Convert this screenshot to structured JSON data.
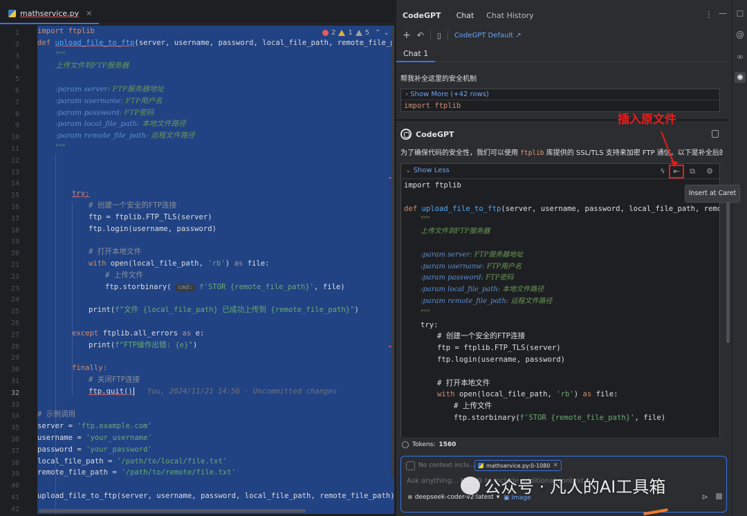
{
  "editor": {
    "file_tab": "mathservice.py",
    "inspection": {
      "errors": "2",
      "warnings": "1",
      "weak": "5"
    },
    "line_numbers": [
      "1",
      "2",
      "3",
      "4",
      "5",
      "6",
      "7",
      "8",
      "9",
      "10",
      "11",
      "12",
      "13",
      "14",
      "15",
      "16",
      "17",
      "18",
      "19",
      "20",
      "21",
      "22",
      "23",
      "24",
      "25",
      "26",
      "27",
      "28",
      "29",
      "30",
      "31",
      "32",
      "33",
      "34",
      "35",
      "36",
      "37",
      "38",
      "39",
      "40",
      "41",
      "42"
    ],
    "current_line": "32",
    "code": {
      "l1": "import ftplib",
      "l2_def": "def ",
      "l2_fn": "upload_file_to_ftp",
      "l2_sig": "(server, username, password, local_file_path, remote_file_path",
      "l3": "\"\"\"",
      "l4": "上传文件到FTP服务器",
      "l6_p": ":param ",
      "l6_k": "server",
      "l6_d": ": FTP服务器地址",
      "l7_p": ":param ",
      "l7_k": "username",
      "l7_d": ": FTP用户名",
      "l8_p": ":param ",
      "l8_k": "password",
      "l8_d": ": FTP密码",
      "l9_p": ":param ",
      "l9_k": "local_file_path",
      "l9_d": ": 本地文件路径",
      "l10_p": ":param ",
      "l10_k": "remote_file_path",
      "l10_d": ": 远程文件路径",
      "l11": "\"\"\"",
      "l15": "try:",
      "l16": "# 创建一个安全的FTP连接",
      "l17": "ftp = ftplib.FTP_TLS(server)",
      "l18": "ftp.login(username, password)",
      "l20": "# 打开本地文件",
      "l21_kw": "with ",
      "l21_a": "open(local_file_path, ",
      "l21_s": "'rb'",
      "l21_b": ") ",
      "l21_as": "as ",
      "l21_c": "file:",
      "l22": "# 上传文件",
      "l23_a": "ftp.storbinary(",
      "l23_hint": "cmd:",
      "l23_s": "f'STOR {remote_file_path}'",
      "l23_b": ", file)",
      "l25_a": "print(",
      "l25_s": "f\"文件 {local_file_path} 已成功上传到 {remote_file_path}\"",
      "l25_b": ")",
      "l27_kw": "except ",
      "l27_a": "ftplib.all_errors ",
      "l27_as": "as ",
      "l27_b": "e:",
      "l28_a": "print(",
      "l28_s": "f\"FTP操作出错: {e}\"",
      "l28_b": ")",
      "l30": "finally:",
      "l31": "# 关闭FTP连接",
      "l32": "ftp.quit()",
      "l32_blame": "You, 2024/11/21 14:56 · Uncommitted changes",
      "l34": "# 示例调用",
      "l35_a": "server = ",
      "l35_s": "'ftp.example.com'",
      "l36_a": "username = ",
      "l36_s": "'your_username'",
      "l37_a": "password = ",
      "l37_s": "'your_password'",
      "l38_a": "local_file_path = ",
      "l38_s": "'/path/to/local/file.txt'",
      "l39_a": "remote_file_path = ",
      "l39_s": "'/path/to/remote/file.txt'",
      "l41": "upload_file_to_ftp(server, username, password, local_file_path, remote_file_path)"
    }
  },
  "panel": {
    "title": "CodeGPT",
    "tabs": [
      "Chat",
      "Chat History"
    ],
    "model_link": "CodeGPT Default ↗",
    "chat_tab": "Chat 1",
    "user_prompt": "帮我补全这里的安全机制",
    "show_more": "Show More (+42 rows)",
    "user_code": "import ftplib",
    "assistant_name": "CodeGPT",
    "intro_a": "为了确保代码的安全性，我们可以使用 ",
    "intro_code": "ftplib",
    "intro_b": " 库提供的 SSL/TLS 支持来加密 FTP 通信。以下是补全后的代码:",
    "show_less": "Show Less",
    "block": {
      "b1": "import ftplib",
      "b3_def": "def ",
      "b3_fn": "upload_file_to_ftp",
      "b3_sig": "(server, username, password, local_file_path, remote_",
      "b4": "\"\"\"",
      "b5": "上传文件到FTP服务器",
      "b7_p": ":param ",
      "b7_k": "server",
      "b7_d": ": FTP服务器地址",
      "b8_p": ":param ",
      "b8_k": "username",
      "b8_d": ": FTP用户名",
      "b9_p": ":param ",
      "b9_k": "password",
      "b9_d": ": FTP密码",
      "b10_p": ":param ",
      "b10_k": "local_file_path",
      "b10_d": ": 本地文件路径",
      "b11_p": ":param ",
      "b11_k": "remote_file_path",
      "b11_d": ": 远程文件路径",
      "b12": "\"\"\"",
      "b13": "try:",
      "b14": "# 创建一个安全的FTP连接",
      "b15": "ftp = ftplib.FTP_TLS(server)",
      "b16": "ftp.login(username, password)",
      "b18": "# 打开本地文件",
      "b19_kw": "with ",
      "b19_a": "open(local_file_path, ",
      "b19_s": "'rb'",
      "b19_b": ") ",
      "b19_as": "as ",
      "b19_c": "file:",
      "b20": "# 上传文件",
      "b21_a": "ftp.storbinary(",
      "b21_s": "f'STOR {remote_file_path}'",
      "b21_b": ", file)"
    },
    "tokens_label": "Tokens:",
    "tokens_value": "1560",
    "context_label": "No context inclu...",
    "file_chip": "mathservice.py:0-1080",
    "input_placeholder": "Ask anything... Use @ to include additional context",
    "model_select": "deepseek-coder-v2:latest",
    "image_btn": "Image"
  },
  "annotation": {
    "callout": "插入原文件",
    "tooltip": "Insert at Caret"
  },
  "watermark": "公众号 · 凡人的AI工具箱",
  "colors": {
    "selection": "#214283",
    "accent": "#3574f0",
    "annotation": "#e81c1c"
  }
}
